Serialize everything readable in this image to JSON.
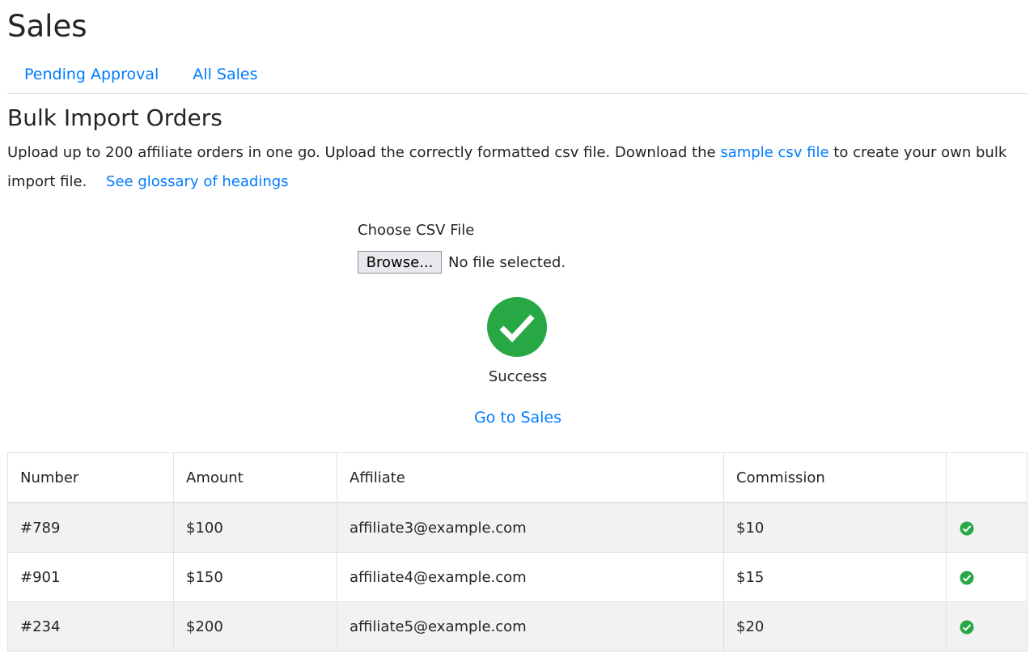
{
  "page": {
    "title": "Sales"
  },
  "tabs": [
    {
      "label": "Pending Approval"
    },
    {
      "label": "All Sales"
    }
  ],
  "import_section": {
    "title": "Bulk Import Orders",
    "description_part1": "Upload up to 200 affiliate orders in one go. Upload the correctly formatted csv file. Download the",
    "sample_link": "sample csv file",
    "description_part2": "to create your own bulk import file.",
    "glossary_link": "See glossary of headings"
  },
  "upload": {
    "label": "Choose CSV File",
    "browse_label": "Browse...",
    "file_status": "No file selected."
  },
  "result": {
    "status_icon": "check-circle-icon",
    "status_text": "Success",
    "status_color": "#28a745",
    "go_to_sales": "Go to Sales"
  },
  "table": {
    "headers": [
      "Number",
      "Amount",
      "Affiliate",
      "Commission",
      ""
    ],
    "rows": [
      {
        "number": "#789",
        "amount": "$100",
        "affiliate": "affiliate3@example.com",
        "commission": "$10",
        "status_icon": "check-circle-icon"
      },
      {
        "number": "#901",
        "amount": "$150",
        "affiliate": "affiliate4@example.com",
        "commission": "$15",
        "status_icon": "check-circle-icon"
      },
      {
        "number": "#234",
        "amount": "$200",
        "affiliate": "affiliate5@example.com",
        "commission": "$20",
        "status_icon": "check-circle-icon"
      }
    ]
  },
  "colors": {
    "link": "#007bff",
    "success": "#28a745",
    "row_stripe": "#f2f2f2",
    "border": "#dee2e6"
  }
}
